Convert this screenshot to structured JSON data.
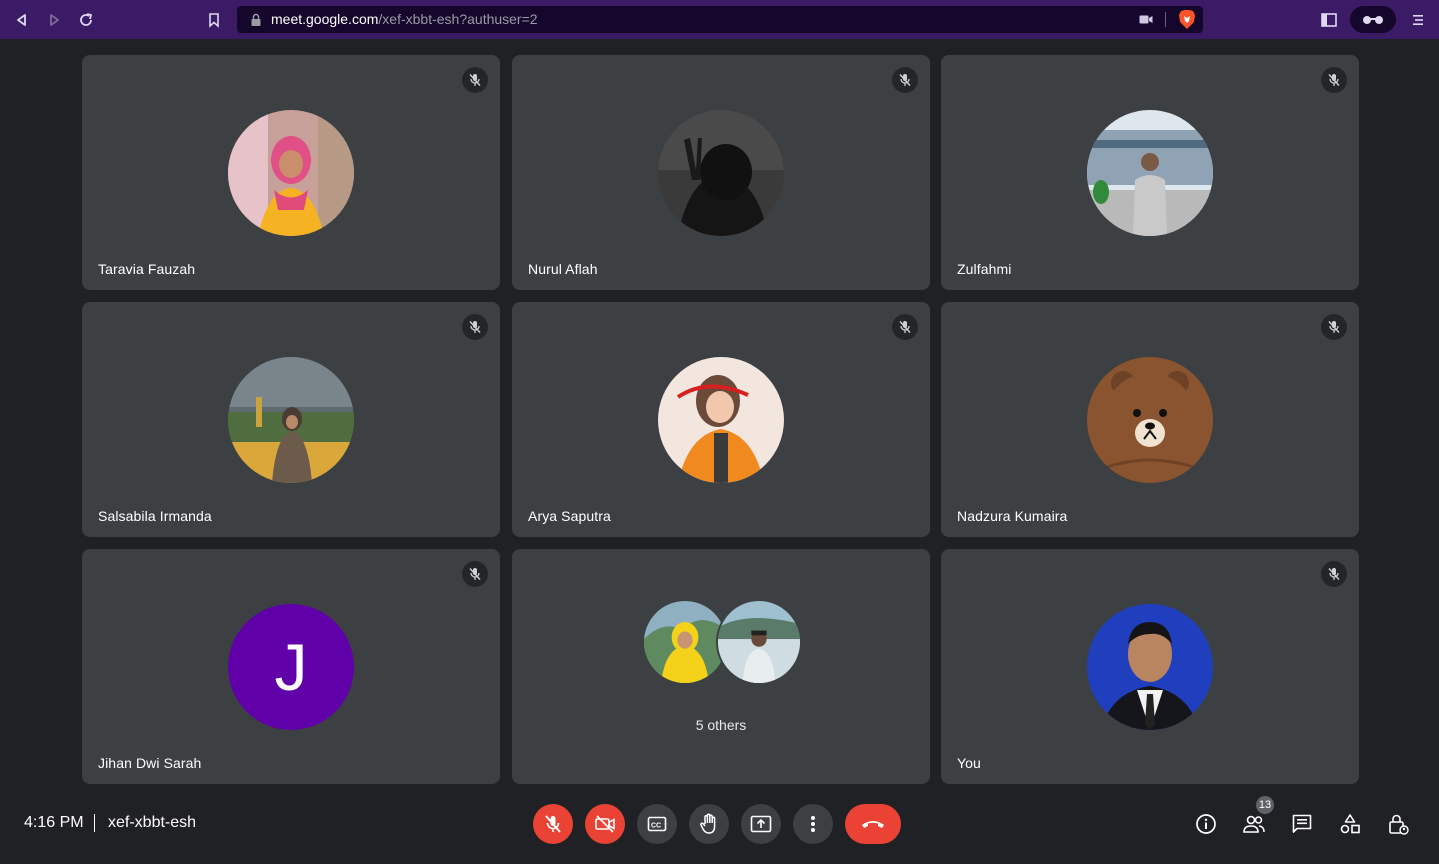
{
  "browser": {
    "url_host": "meet.google.com",
    "url_path": "/xef-xbbt-esh?authuser=2"
  },
  "participants": [
    {
      "name": "Taravia Fauzah",
      "muted": true,
      "avatar": "photo"
    },
    {
      "name": "Nurul Aflah",
      "muted": true,
      "avatar": "photo"
    },
    {
      "name": "Zulfahmi",
      "muted": true,
      "avatar": "photo"
    },
    {
      "name": "Salsabila Irmanda",
      "muted": true,
      "avatar": "photo"
    },
    {
      "name": "Arya Saputra",
      "muted": true,
      "avatar": "photo"
    },
    {
      "name": "Nadzura Kumaira",
      "muted": true,
      "avatar": "photo"
    },
    {
      "name": "Jihan Dwi Sarah",
      "muted": true,
      "avatar": "initial",
      "initial": "J"
    },
    {
      "name": "",
      "others_label": "5 others"
    },
    {
      "name": "You",
      "muted": true,
      "avatar": "photo"
    }
  ],
  "footer": {
    "time": "4:16 PM",
    "meeting_code": "xef-xbbt-esh",
    "people_count": "13"
  },
  "controls": [
    "mic-off",
    "camera-off",
    "captions",
    "raise-hand",
    "present",
    "more-options",
    "leave-call"
  ],
  "right_controls": [
    "meeting-details",
    "people",
    "chat",
    "activities",
    "host-controls"
  ],
  "colors": {
    "background": "#202124",
    "tile": "#3c4043",
    "danger": "#ea4335",
    "browser_bar": "#3b1a66",
    "initial_avatar": "#5f00a8"
  }
}
